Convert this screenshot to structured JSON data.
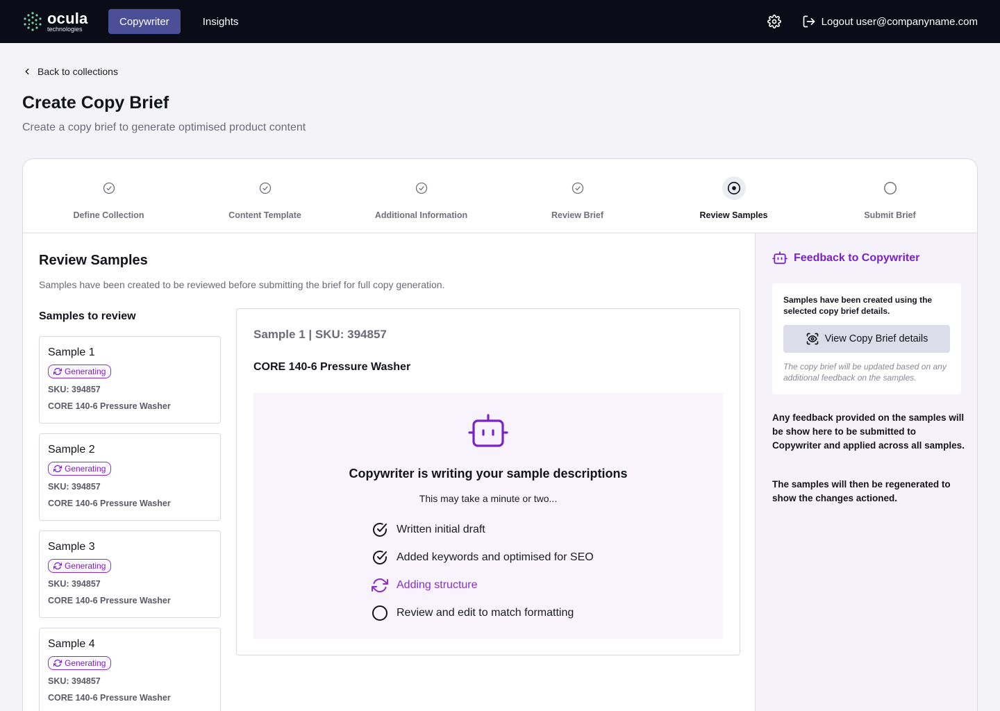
{
  "nav": {
    "logo_name": "ocula",
    "logo_sub": "technologies",
    "tabs": [
      {
        "label": "Copywriter",
        "active": true
      },
      {
        "label": "Insights",
        "active": false
      }
    ],
    "logout_label": "Logout user@companyname.com"
  },
  "header": {
    "back_label": "Back to collections",
    "title": "Create Copy Brief",
    "subtitle": "Create a copy brief to generate optimised product content"
  },
  "stepper": {
    "steps": [
      {
        "label": "Define Collection",
        "state": "done"
      },
      {
        "label": "Content Template",
        "state": "done"
      },
      {
        "label": "Additional Information",
        "state": "done"
      },
      {
        "label": "Review Brief",
        "state": "done"
      },
      {
        "label": "Review Samples",
        "state": "active"
      },
      {
        "label": "Submit Brief",
        "state": "pending"
      }
    ]
  },
  "review": {
    "title": "Review Samples",
    "subtitle": "Samples have been created to be reviewed before submitting the brief for full copy generation.",
    "list_title": "Samples to review",
    "samples": [
      {
        "name": "Sample 1",
        "status": "Generating",
        "sku": "SKU: 394857",
        "product": "CORE 140-6 Pressure Washer"
      },
      {
        "name": "Sample 2",
        "status": "Generating",
        "sku": "SKU: 394857",
        "product": "CORE 140-6 Pressure Washer"
      },
      {
        "name": "Sample 3",
        "status": "Generating",
        "sku": "SKU: 394857",
        "product": "CORE 140-6 Pressure Washer"
      },
      {
        "name": "Sample 4",
        "status": "Generating",
        "sku": "SKU: 394857",
        "product": "CORE 140-6 Pressure Washer"
      }
    ]
  },
  "detail": {
    "heading": "Sample 1 | SKU: 394857",
    "product": "CORE 140-6 Pressure Washer",
    "gen_title": "Copywriter is writing your sample descriptions",
    "gen_sub": "This may take a minute or two...",
    "tasks": [
      {
        "label": "Written initial draft",
        "state": "done"
      },
      {
        "label": "Added keywords and optimised for SEO",
        "state": "done"
      },
      {
        "label": "Adding structure",
        "state": "in-progress"
      },
      {
        "label": "Review and edit to match formatting",
        "state": "pending"
      }
    ]
  },
  "feedback": {
    "title": "Feedback to Copywriter",
    "box_text": "Samples have been created using the selected copy brief details.",
    "button_label": "View Copy Brief details",
    "note": "The copy brief will be updated based on any additional feedback on the samples.",
    "para1": "Any feedback provided on the samples will be show here to be submitted to Copywriter and applied across all samples.",
    "para2": "The samples will then be regenerated to show the changes actioned."
  },
  "colors": {
    "nav_bg": "#0b0c18",
    "nav_active": "#4b4f98",
    "accent_purple": "#7a22c2",
    "gen_bg": "#f8f3fd"
  }
}
